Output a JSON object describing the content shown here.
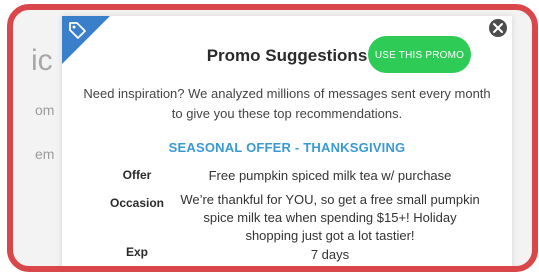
{
  "background": {
    "heading_fragment": "ic",
    "row1_fragment": "om",
    "row2_fragment": "em"
  },
  "modal": {
    "title": "Promo Suggestions",
    "use_button": "USE THIS PROMO",
    "intro": "Need inspiration? We analyzed millions of messages sent every month to give you these top recommendations.",
    "section_heading": "SEASONAL OFFER - THANKSGIVING",
    "fields": {
      "offer_label": "Offer",
      "offer_value": "Free pumpkin spiced milk tea w/ purchase",
      "occasion_label": "Occasion",
      "occasion_value": "We’re thankful for YOU, so get a free small pumpkin spice milk tea when spending $15+! Holiday shopping just got a lot tastier!",
      "exp_label": "Exp",
      "exp_value": "7 days"
    }
  },
  "icons": {
    "corner": "tag-icon",
    "close": "close-icon"
  },
  "colors": {
    "frame_border": "#d9474a",
    "corner_accent": "#3a7fc9",
    "button_green": "#2ecc57",
    "section_blue": "#3a9ad6"
  }
}
